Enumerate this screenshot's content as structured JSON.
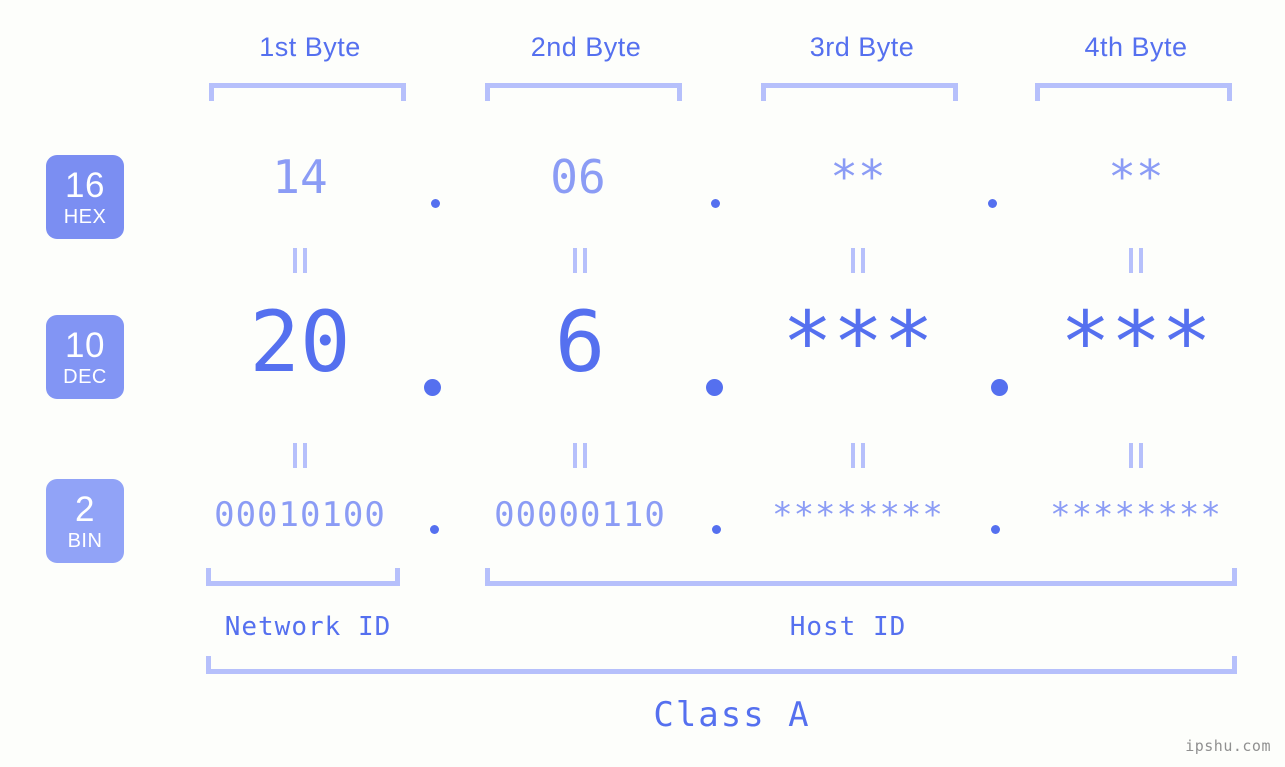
{
  "watermark": "ipshu.com",
  "colors": {
    "background": "#fdfefb",
    "accent_strong": "#5570ef",
    "accent_light": "#8b9cf5",
    "bracket": "#b6c0fb",
    "badge_hex": "#7b8ef2",
    "badge_dec": "#8295f4",
    "badge_bin": "#91a3f7",
    "watermark": "#909090"
  },
  "headers": [
    {
      "label": "1st Byte",
      "name": "byte-header-1"
    },
    {
      "label": "2nd Byte",
      "name": "byte-header-2"
    },
    {
      "label": "3rd Byte",
      "name": "byte-header-3"
    },
    {
      "label": "4th Byte",
      "name": "byte-header-4"
    }
  ],
  "bases": [
    {
      "number": "16",
      "name": "HEX"
    },
    {
      "number": "10",
      "name": "DEC"
    },
    {
      "number": "2",
      "name": "BIN"
    }
  ],
  "rows": {
    "hex": {
      "base_number": "16",
      "base_name": "HEX",
      "values": [
        "14",
        "06",
        "**",
        "**"
      ],
      "separator": "."
    },
    "dec": {
      "base_number": "10",
      "base_name": "DEC",
      "values": [
        "20",
        "6",
        "***",
        "***"
      ],
      "separator": "."
    },
    "bin": {
      "base_number": "2",
      "base_name": "BIN",
      "values": [
        "00010100",
        "00000110",
        "********",
        "********"
      ],
      "separator": "."
    }
  },
  "equality_marks": [
    "=",
    "=",
    "=",
    "=",
    "=",
    "=",
    "=",
    "="
  ],
  "sections": [
    {
      "label": "Network ID",
      "name": "network-id"
    },
    {
      "label": "Host ID",
      "name": "host-id"
    }
  ],
  "class": {
    "label": "Class A"
  },
  "ip_address": {
    "hex": "14.06.**.**",
    "dec": "20.6.***.***",
    "bin": "00010100.00000110.********.********"
  }
}
